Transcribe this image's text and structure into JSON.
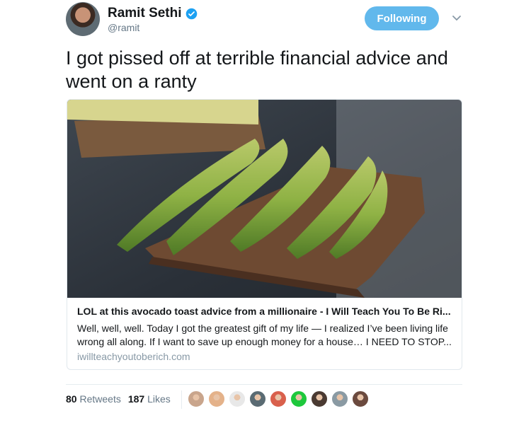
{
  "user": {
    "name": "Ramit Sethi",
    "handle": "@ramit",
    "verified": true
  },
  "follow_button": {
    "label": "Following"
  },
  "tweet": {
    "text": "I got pissed off at terrible financial advice and went on a ranty"
  },
  "card": {
    "title": "LOL at this avocado toast advice from a millionaire - I Will Teach You To Be Ri...",
    "description": "Well, well, well. Today I got the greatest gift of my life — I realized I’ve been living life wrong all along. If I want to save up enough money for a house… I NEED TO STOP...",
    "domain": "iwillteachyoutoberich.com"
  },
  "stats": {
    "retweets_count": "80",
    "retweets_label": "Retweets",
    "likes_count": "187",
    "likes_label": "Likes"
  },
  "likers": [
    {
      "color": "#c9a58c"
    },
    {
      "color": "#e4b28a"
    },
    {
      "color": "#e8e8e8"
    },
    {
      "color": "#5a6b73"
    },
    {
      "color": "#d9604c"
    },
    {
      "color": "#1ec83c"
    },
    {
      "color": "#4a3a32"
    },
    {
      "color": "#8a9aa3"
    },
    {
      "color": "#6b4a3e"
    }
  ],
  "colors": {
    "accent": "#61b8ec",
    "verified": "#1da1f2",
    "muted": "#657786"
  }
}
